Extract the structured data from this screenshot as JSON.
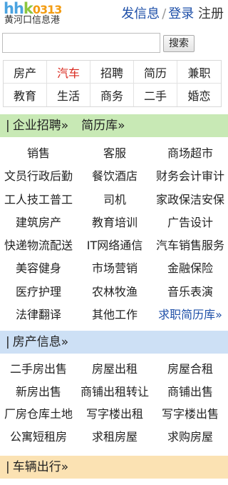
{
  "header": {
    "logo_mark_a": "hh",
    "logo_mark_b": "k",
    "logo_mark_num": "0313",
    "logo_sub": "黄河口信息港",
    "post_link": "发信息",
    "separator": "/",
    "login_link": "登录",
    "register_link": "注册"
  },
  "search": {
    "placeholder": "",
    "button_label": "搜索"
  },
  "categories": [
    "房产",
    "汽车",
    "招聘",
    "简历",
    "兼职",
    "教育",
    "生活",
    "商务",
    "二手",
    "婚恋"
  ],
  "active_category": "汽车",
  "sections": {
    "jobs": {
      "pipe": "|",
      "title": "企业招聘»",
      "sub_title": "简历库»",
      "links": [
        "销售",
        "客服",
        "商场超市",
        "文员行政后勤",
        "餐饮酒店",
        "财务会计审计",
        "工人技工普工",
        "司机",
        "家政保洁安保",
        "建筑房产",
        "教育培训",
        "广告设计",
        "快递物流配送",
        "IT网络通信",
        "汽车销售服务",
        "美容健身",
        "市场营销",
        "金融保险",
        "医疗护理",
        "农林牧渔",
        "音乐表演",
        "法律翻译",
        "其他工作",
        "求职简历库»"
      ]
    },
    "house": {
      "pipe": "|",
      "title": "房产信息»",
      "links": [
        "二手房出售",
        "房屋出租",
        "房屋合租",
        "新房出售",
        "商铺出租转让",
        "商铺出售",
        "厂房仓库土地",
        "写字楼出租",
        "写字楼出售",
        "公寓短租房",
        "求租房屋",
        "求购房屋"
      ]
    },
    "vehicles": {
      "pipe": "|",
      "title": "车辆出行»"
    }
  },
  "colors": {
    "link_blue": "#1e4fa8",
    "active_red": "#d9281e",
    "jobs_bar": "#c8e9b5",
    "house_bar": "#cde0f5",
    "vehicle_bar": "#fbe2b3"
  }
}
